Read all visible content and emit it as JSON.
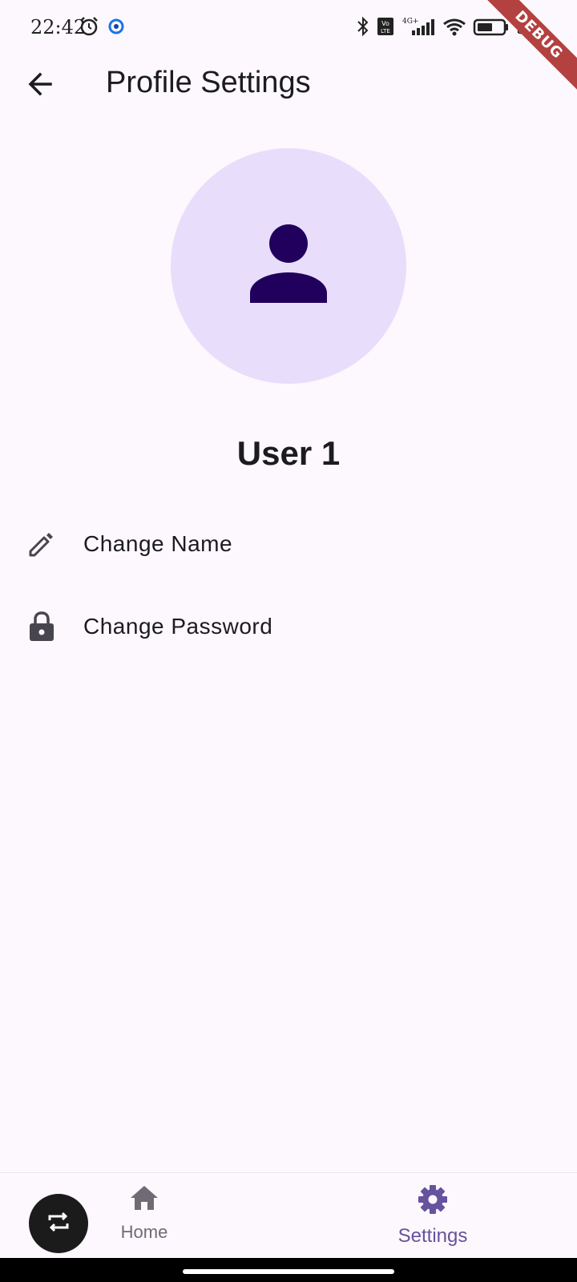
{
  "status_bar": {
    "time": "22:42",
    "battery_text": "54",
    "network_label": "4G+",
    "volte_label": "Vo LTE"
  },
  "debug_banner": "DEBUG",
  "app_bar": {
    "title": "Profile Settings",
    "back_icon": "arrow-left-icon"
  },
  "profile": {
    "avatar_icon": "person-icon",
    "name": "User 1",
    "avatar_bg_color": "#e8defb",
    "avatar_icon_color": "#21005d"
  },
  "menu": {
    "items": [
      {
        "label": "Change Name",
        "icon": "pencil-icon"
      },
      {
        "label": "Change Password",
        "icon": "lock-icon"
      }
    ]
  },
  "bottom_nav": {
    "fab_icon": "swap-icon",
    "items": [
      {
        "label": "Home",
        "icon": "home-icon",
        "selected": false
      },
      {
        "label": "Settings",
        "icon": "gear-icon",
        "selected": true
      }
    ],
    "accent_color": "#66529e"
  }
}
